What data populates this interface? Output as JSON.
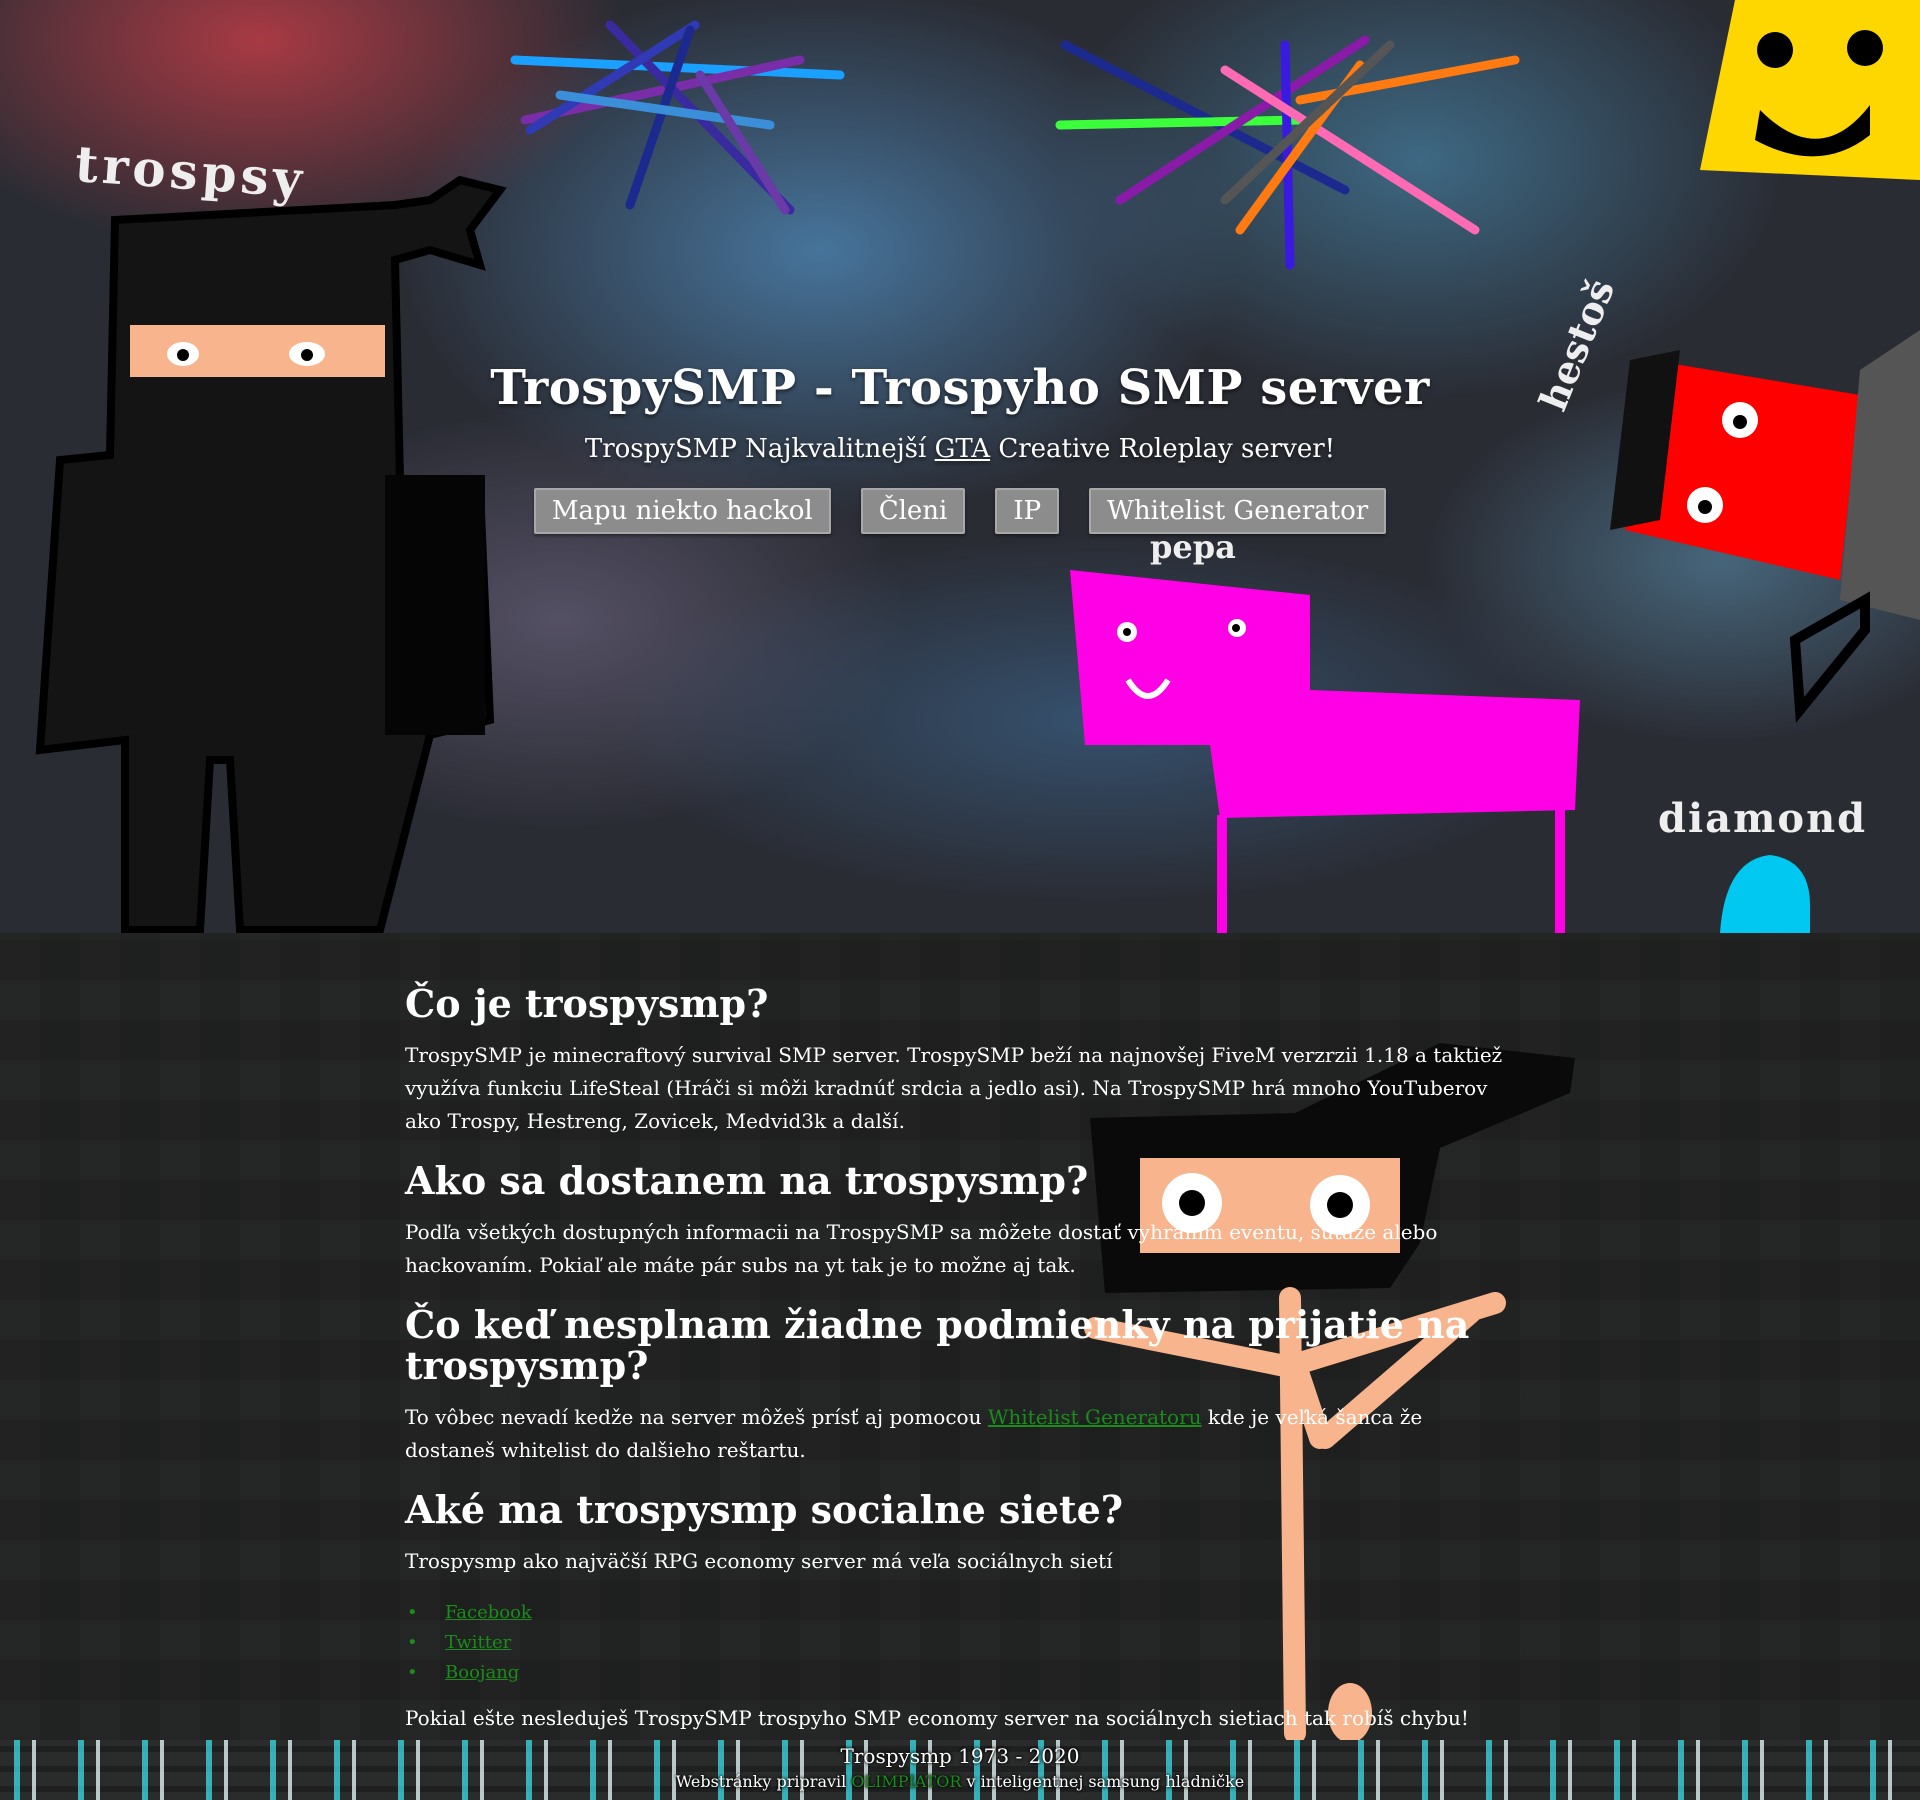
{
  "hero": {
    "title": "TrospySMP - Trospyho SMP server",
    "subtitle_before": "TrospySMP Najkvalitnejší",
    "subtitle_link": "GTA",
    "subtitle_after": "Creative Roleplay server!",
    "buttons": [
      "Mapu niekto hackol",
      "Členi",
      "IP",
      "Whitelist Generator"
    ],
    "art_labels": {
      "trospsy": "trospsy",
      "pepa": "pepa",
      "hestos": "hestoš",
      "diamond": "diamond"
    }
  },
  "sections": [
    {
      "heading": "Čo je trospysmp?",
      "text": "TrospySMP je minecraftový survival SMP server. TrospySMP beží na najnovšej FiveM verzrzii 1.18 a taktiež využíva funkciu LifeSteal (Hráči si môži kradnúť srdcia a jedlo asi). Na TrospySMP hrá mnoho YouTuberov ako Trospy, Hestreng, Zovicek, Medvid3k a další."
    },
    {
      "heading": "Ako sa dostanem na trospysmp?",
      "text": "Podľa všetkých dostupných informacii na TrospySMP sa môžete dostať vyhraním eventu, súťaže alebo hackovaním. Pokiaľ ale máte pár subs na yt tak je to možne aj tak."
    },
    {
      "heading": "Čo keď nesplnam žiadne podmienky na prijatie na trospysmp?",
      "text_before": "To vôbec nevadí kedže na server môžeš prísť aj pomocou",
      "link": "Whitelist Generatoru",
      "text_after": "kde je veľká šanca že dostaneš whitelist do dalšieho reštartu."
    },
    {
      "heading": "Aké ma trospysmp socialne siete?",
      "text": "Trospysmp ako najväčší RPG economy server má veľa sociálnych sietí",
      "links": [
        "Facebook",
        "Twitter",
        "Boojang"
      ],
      "closing": "Pokial ešte nesleduješ TrospySMP trospyho SMP economy server na sociálnych sietiach tak robíš chybu!"
    }
  ],
  "footer": {
    "line1": "Trospysmp 1973 - 2020",
    "line2_before": "Webstránky pripravil",
    "line2_link": "OLIMPIATOR",
    "line2_after": "v inteligentnej samsung hladničke"
  },
  "colors": {
    "link_green": "#1a8c1a",
    "button_gray": "#8c8c8c",
    "page_dark": "#1f2020",
    "pepa_magenta": "#ff00e6",
    "hestos_red": "#ff0000",
    "smiley_yellow": "#ffd700",
    "ninja_skin": "#f8b48c"
  }
}
